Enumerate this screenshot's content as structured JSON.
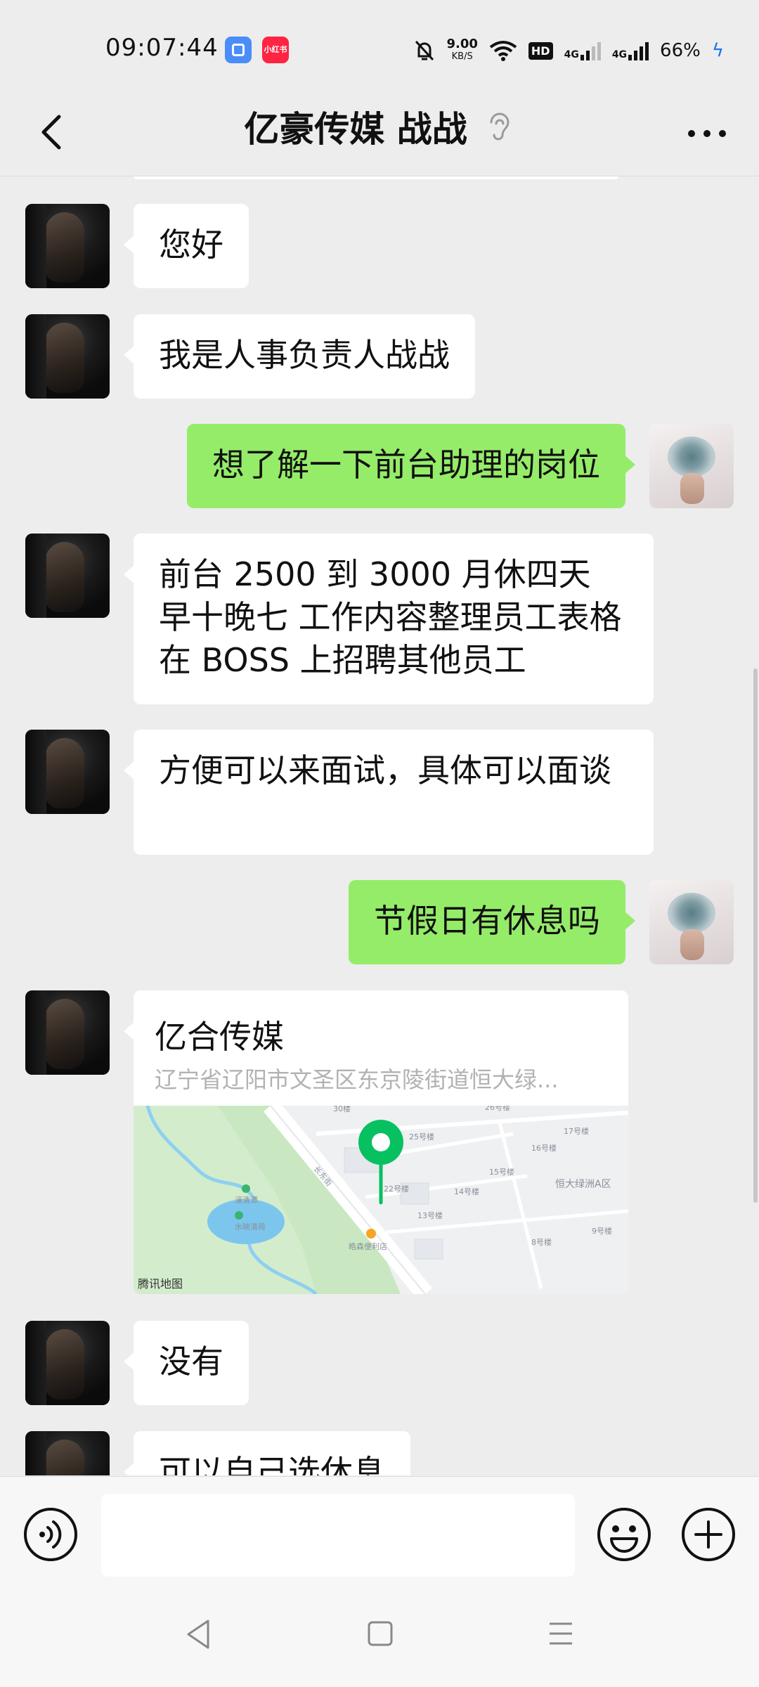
{
  "status": {
    "time": "09:07:44",
    "app_badge_2": "小红书",
    "net_speed": "9.00",
    "net_unit": "KB/S",
    "hd": "HD",
    "sig1": "4G",
    "sig2": "4G",
    "battery": "66%"
  },
  "header": {
    "title": "亿豪传媒 战战"
  },
  "messages": [
    {
      "side": "in",
      "text": "您好"
    },
    {
      "side": "in",
      "text": "我是人事负责人战战"
    },
    {
      "side": "out",
      "text": "想了解一下前台助理的岗位"
    },
    {
      "side": "in",
      "text": "前台 2500 到 3000 月休四天 早十晚七 工作内容整理员工表格在 BOSS 上招聘其他员工"
    },
    {
      "side": "in",
      "text": "方便可以来面试，具体可以面谈"
    },
    {
      "side": "out",
      "text": "节假日有休息吗"
    },
    {
      "side": "in",
      "type": "location"
    },
    {
      "side": "in",
      "text": "没有"
    },
    {
      "side": "in",
      "text": "可以自己选休息"
    }
  ],
  "location": {
    "name": "亿合传媒",
    "address": "辽宁省辽阳市文圣区东京陵街道恒大绿...",
    "credit": "腾讯地图",
    "map_labels": [
      "30楼",
      "26号楼",
      "25号楼",
      "17号楼",
      "16号楼",
      "15号楼",
      "14号楼",
      "22号楼",
      "13号楼",
      "恒大绿洲A区",
      "9号楼",
      "8号楼",
      "濠清潭",
      "水映清荷",
      "皓森便利店",
      "长东街"
    ]
  },
  "composer": {
    "placeholder": ""
  },
  "colors": {
    "outgoing_bubble": "#95ec69",
    "incoming_bubble": "#ffffff",
    "background": "#ededed",
    "map_pin": "#07c160"
  }
}
